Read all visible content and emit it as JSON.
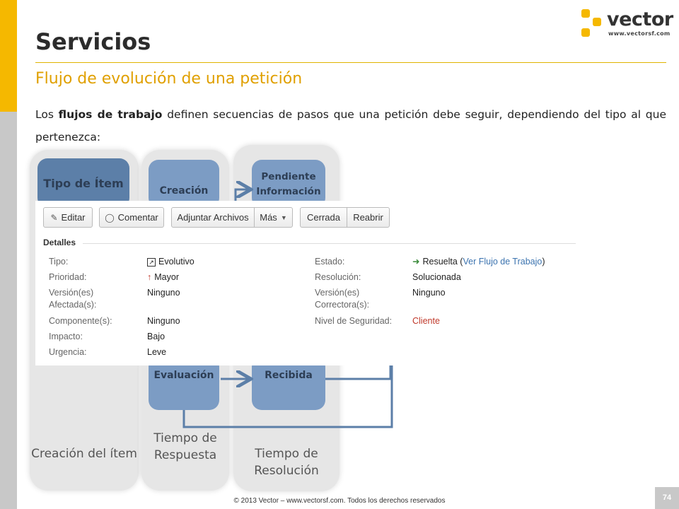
{
  "logo": {
    "text": "vector",
    "sub": "www.vectorsf.com",
    "colors": {
      "orange": "#f5b800",
      "dark": "#333333"
    }
  },
  "slide": {
    "title": "Servicios",
    "subtitle": "Flujo de evolución de una petición",
    "paragraph": {
      "before": "Los ",
      "bold": "flujos de trabajo",
      "after": " definen secuencias de pasos que una petición debe seguir, dependiendo del tipo al que pertenezca:"
    }
  },
  "diagram": {
    "columns": [
      {
        "label": "Creación del ítem"
      },
      {
        "label": "Tiempo de Respuesta"
      },
      {
        "label": "Tiempo de Resolución"
      }
    ],
    "boxes": {
      "tipo_item": "Tipo de Ítem",
      "creacion": "Creación",
      "pendiente_informacion": "Pendiente Información",
      "evaluacion": "Evaluación",
      "recibida": "Recibida"
    }
  },
  "issue_panel": {
    "toolbar": {
      "edit": "Editar",
      "comment": "Comentar",
      "attach": "Adjuntar Archivos",
      "more": "Más",
      "closed": "Cerrada",
      "reopen": "Reabrir"
    },
    "details_title": "Detalles",
    "left_fields": [
      {
        "label": "Tipo:",
        "value": "Evolutivo"
      },
      {
        "label": "Prioridad:",
        "value": "Mayor"
      },
      {
        "label": "Versión(es) Afectada(s):",
        "value": "Ninguno"
      },
      {
        "label": "Componente(s):",
        "value": "Ninguno"
      },
      {
        "label": "Impacto:",
        "value": "Bajo"
      },
      {
        "label": "Urgencia:",
        "value": "Leve"
      }
    ],
    "right_fields": {
      "estado": {
        "label": "Estado:",
        "value": "Resuelta",
        "link": "Ver Flujo de Trabajo"
      },
      "resolucion": {
        "label": "Resolución:",
        "value": "Solucionada"
      },
      "version_correctora": {
        "label": "Versión(es) Correctora(s):",
        "value": "Ninguno"
      },
      "seguridad": {
        "label": "Nivel de Seguridad:",
        "value": "Cliente"
      }
    }
  },
  "page_number": "74",
  "footer": "© 2013 Vector – www.vectorsf.com. Todos los derechos reservados",
  "colors": {
    "accent": "#f5b800",
    "subtitle": "#e0a000",
    "box_dark": "#5c7fa8",
    "box_mid": "#7c9cc4",
    "link": "#3b73af",
    "danger": "#c0392b"
  }
}
